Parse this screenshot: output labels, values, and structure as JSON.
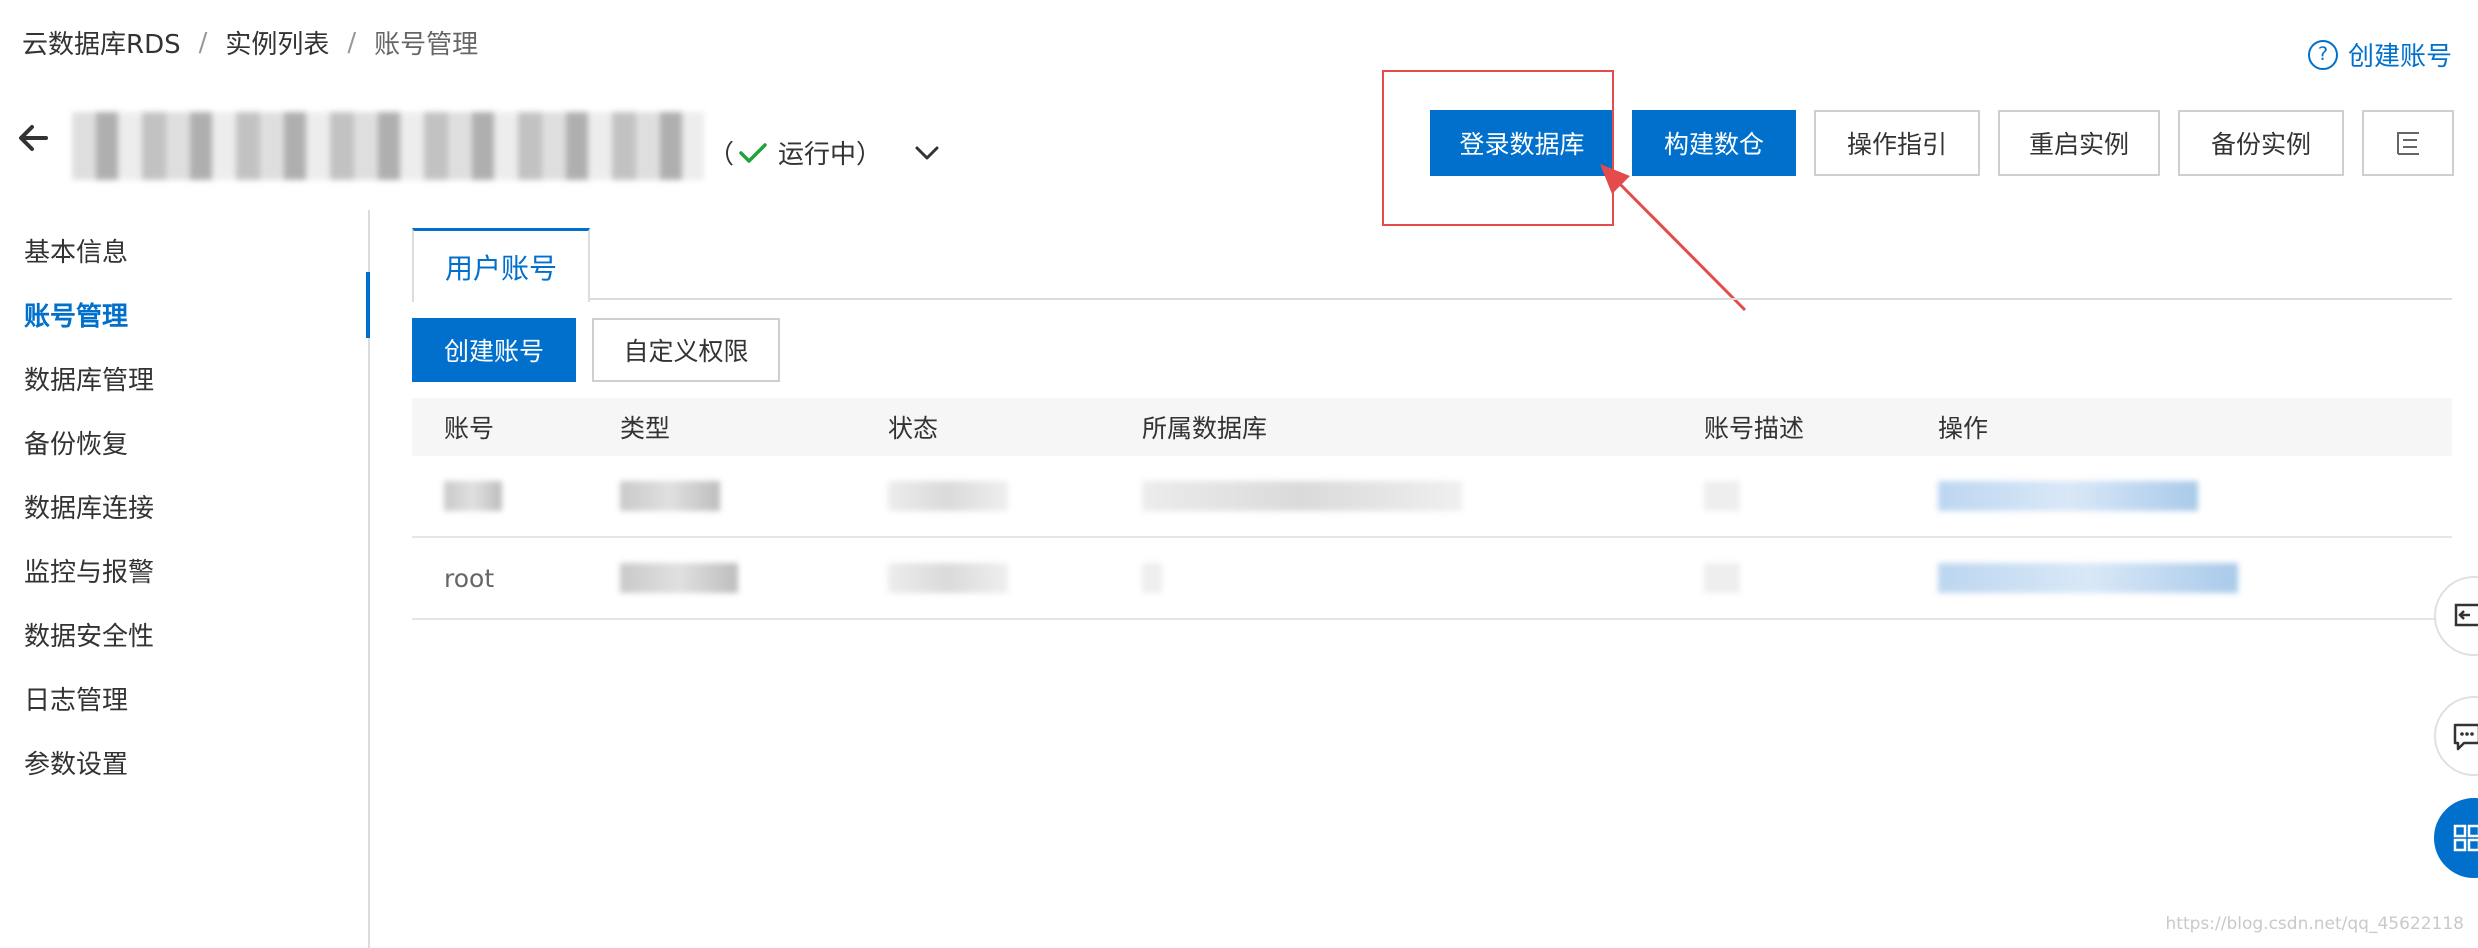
{
  "breadcrumb": {
    "items": [
      "云数据库RDS",
      "实例列表",
      "账号管理"
    ],
    "separator": "/"
  },
  "help_link": {
    "icon": "question-circle-icon",
    "label": "创建账号"
  },
  "header": {
    "status_open": "（",
    "status_text": "运行中",
    "status_close": "）"
  },
  "actions": {
    "login": "登录数据库",
    "build_warehouse": "构建数仓",
    "guide": "操作指引",
    "reboot": "重启实例",
    "backup": "备份实例"
  },
  "sidebar": {
    "items": [
      "基本信息",
      "账号管理",
      "数据库管理",
      "备份恢复",
      "数据库连接",
      "监控与报警",
      "数据安全性",
      "日志管理",
      "参数设置"
    ],
    "active": "账号管理"
  },
  "tabs": {
    "user_accounts": "用户账号"
  },
  "sub_actions": {
    "create": "创建账号",
    "custom_perms": "自定义权限"
  },
  "table": {
    "columns": [
      "账号",
      "类型",
      "状态",
      "所属数据库",
      "账号描述",
      "操作"
    ],
    "rows": [
      {
        "account": ""
      },
      {
        "account": "root"
      }
    ]
  },
  "watermark": "https://blog.csdn.net/qq_45622118",
  "colors": {
    "primary": "#0070cc",
    "annotation": "#e44b4b",
    "success": "#21a33a"
  }
}
